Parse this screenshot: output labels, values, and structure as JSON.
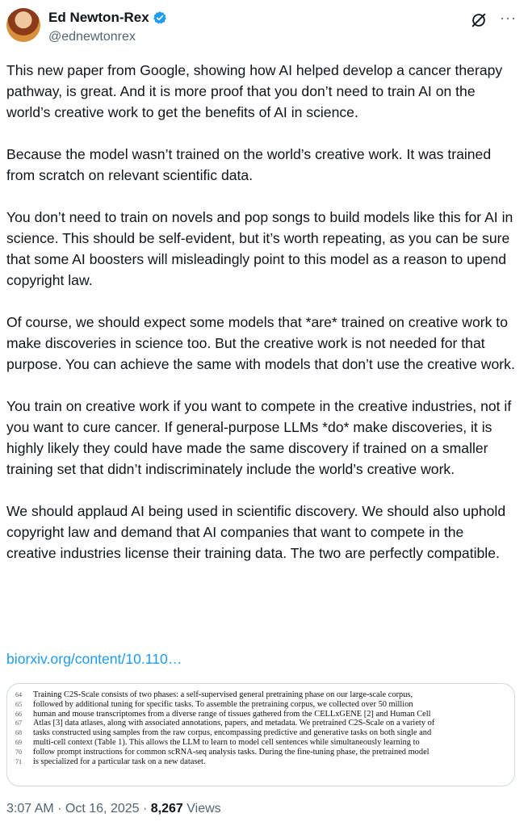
{
  "author": {
    "name": "Ed Newton-Rex",
    "handle": "@ednewtonrex",
    "verified_color": "#1d9bf0"
  },
  "actions": {
    "grok_icon": "grok-icon",
    "more_label": "···"
  },
  "tweet": {
    "paragraphs": [
      "This new paper from Google, showing how AI helped develop a cancer therapy pathway, is great. And it is more proof that you don’t need to train AI on the world’s creative work to get the benefits of AI in science.",
      "Because the model wasn’t trained on the world’s creative work. It was trained from scratch on relevant scientific data.",
      "You don’t need to train on novels and pop songs to build models like this for AI in science. This should be self-evident, but it’s worth repeating, as you can be sure that some AI boosters will misleadingly point to this model as a reason to upend copyright law.",
      "Of course, we should expect some models that *are* trained on creative work to make discoveries in science too. But the creative work is not needed for that purpose. You can achieve the same with models that don’t use the creative work.",
      "You train on creative work if you want to compete in the creative industries, not if you want to cure cancer. If general-purpose LLMs *do* make discoveries, it is highly likely they could have made the same discovery if trained on a smaller training set that didn’t indiscriminately include the world’s creative work.",
      "We should applaud AI being used in scientific discovery. We should also uphold copyright law and demand that AI companies that want to compete in the creative industries license their training data. The two are perfectly compatible."
    ],
    "link": "biorxiv.org/content/10.110…"
  },
  "paper_excerpt": {
    "lines": [
      {
        "num": "64",
        "text": "Training C2S-Scale consists of two phases: a self-supervised general pretraining phase on our large-scale corpus,"
      },
      {
        "num": "65",
        "text": "followed by additional tuning for specific tasks. To assemble the pretraining corpus, we collected over 50 million"
      },
      {
        "num": "66",
        "text": "human and mouse transcriptomes from a diverse range of tissues gathered from the CELLxGENE [2] and Human Cell"
      },
      {
        "num": "67",
        "text": "Atlas [3] data atlases, along with associated annotations, papers, and metadata. We pretrained C2S-Scale on a variety of"
      },
      {
        "num": "68",
        "text": "tasks constructed using samples from the raw corpus, encompassing predictive and generative tasks on both single and"
      },
      {
        "num": "69",
        "text": "multi-cell context (Table 1). This allows the LLM to learn to model cell sentences while simultaneously learning to"
      },
      {
        "num": "70",
        "text": "follow prompt instructions for common scRNA-seq analysis tasks. During the fine-tuning phase, the pretrained model"
      },
      {
        "num": "71",
        "text": "is specialized for a particular task on a new dataset."
      }
    ]
  },
  "meta": {
    "timestamp": "3:07 AM · Oct 16, 2025 · ",
    "views_count": "8,267",
    "views_label": " Views"
  }
}
